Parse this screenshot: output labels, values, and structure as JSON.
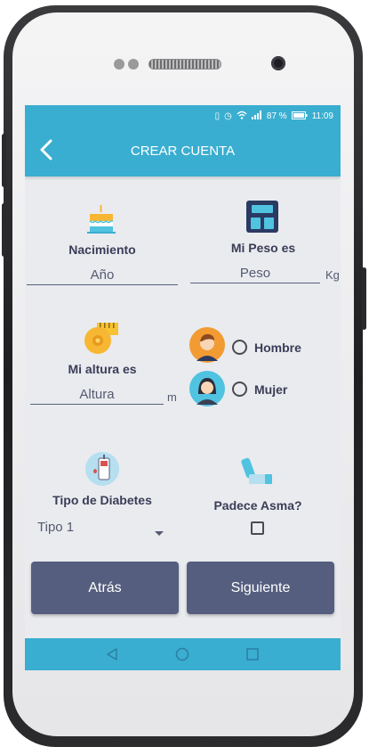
{
  "status_bar": {
    "battery": "87 %",
    "time": "11:09"
  },
  "app_bar": {
    "title": "CREAR CUENTA"
  },
  "birth": {
    "label": "Nacimiento",
    "value": "Año"
  },
  "weight": {
    "label": "Mi Peso es",
    "value": "Peso",
    "unit": "Kg"
  },
  "height": {
    "label": "Mi altura es",
    "value": "Altura",
    "unit": "m"
  },
  "gender": {
    "male_label": "Hombre",
    "female_label": "Mujer"
  },
  "diabetes": {
    "label": "Tipo de Diabetes",
    "selected": "Tipo 1"
  },
  "asthma": {
    "label": "Padece Asma?"
  },
  "buttons": {
    "back_label": "Atrás",
    "next_label": "Siguiente"
  },
  "colors": {
    "primary": "#3aaed0",
    "button": "#555e7e",
    "background": "#e9ebef",
    "label": "#3b3d57"
  },
  "icons": [
    "back-arrow-icon",
    "birthday-cake-icon",
    "scale-icon",
    "measuring-tape-icon",
    "male-avatar-icon",
    "female-avatar-icon",
    "glucometer-icon",
    "inhaler-icon",
    "dropdown-arrow-icon",
    "nav-back-icon",
    "nav-home-icon",
    "nav-recents-icon"
  ]
}
